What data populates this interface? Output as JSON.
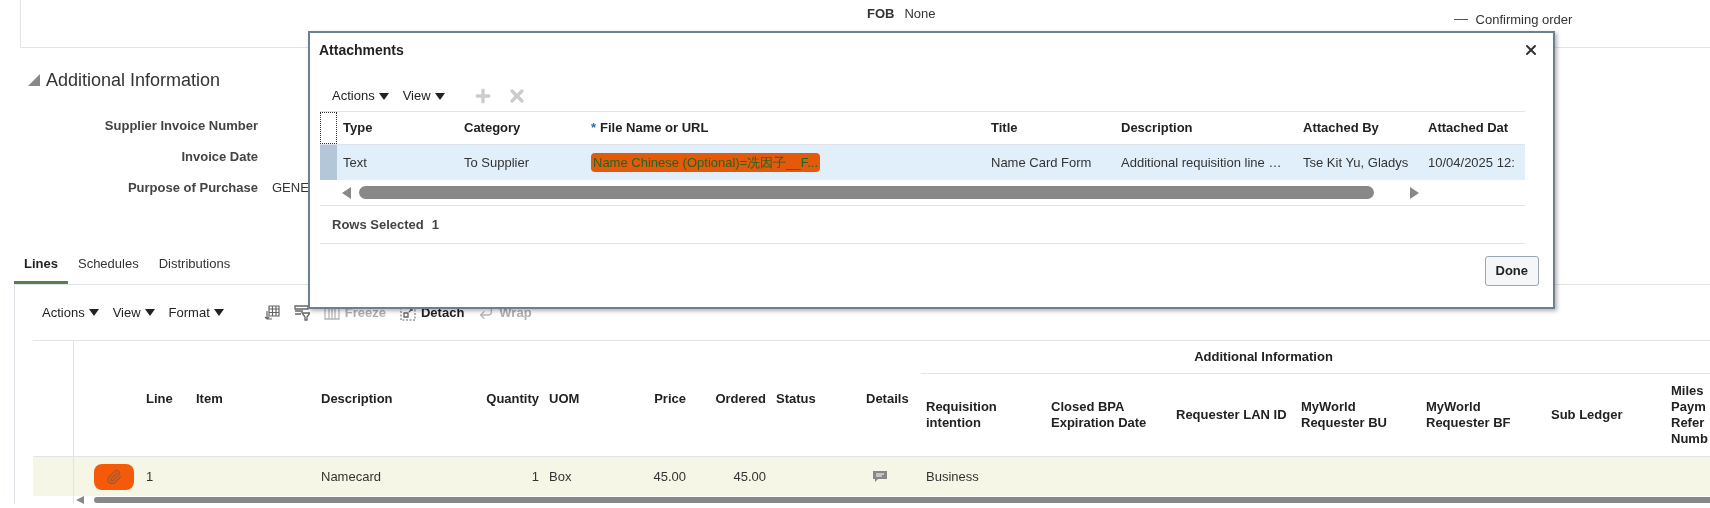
{
  "header": {
    "fob_label": "FOB",
    "fob_value": "None",
    "status_text": "Confirming order"
  },
  "additional_information": {
    "title": "Additional Information",
    "expanded": true,
    "fields": [
      {
        "label": "Supplier Invoice Number"
      },
      {
        "label": "Invoice Date"
      },
      {
        "label": "Purpose of Purchase",
        "value": "GENE"
      }
    ]
  },
  "tabs": [
    {
      "label": "Lines",
      "selected": true
    },
    {
      "label": "Schedules",
      "selected": false
    },
    {
      "label": "Distributions",
      "selected": false
    }
  ],
  "lines_toolbar": {
    "menus": [
      "Actions",
      "View",
      "Format"
    ],
    "buttons": [
      {
        "kind": "columns",
        "disabled": false
      },
      {
        "kind": "filter",
        "disabled": false
      },
      {
        "kind": "freeze",
        "label": "Freeze",
        "disabled": true
      },
      {
        "kind": "detach",
        "label": "Detach",
        "disabled": false
      },
      {
        "kind": "wrap",
        "label": "Wrap",
        "disabled": true
      }
    ]
  },
  "lines_table": {
    "group_header": "Additional Information",
    "columns": [
      "Line",
      "Item",
      "Description",
      "Quantity",
      "UOM",
      "Price",
      "Ordered",
      "Status",
      "Details"
    ],
    "group_columns": [
      "Requisition intention",
      "Closed BPA Expiration Date",
      "Requester LAN ID",
      "MyWorld Requester BU",
      "MyWorld Requester BF",
      "Sub Ledger",
      "Miles Paym Refer Numb"
    ],
    "rows": [
      {
        "selected": true,
        "attachment": true,
        "details": true,
        "line": "1",
        "description": "Namecard",
        "quantity": "1",
        "uom": "Box",
        "price": "45.00",
        "ordered": "45.00",
        "requisition_intention": "Business"
      }
    ]
  },
  "dialog": {
    "title": "Attachments",
    "toolbar": {
      "menus": [
        "Actions",
        "View"
      ],
      "add_disabled": true,
      "delete_disabled": true
    },
    "columns": [
      {
        "label": "Type"
      },
      {
        "label": "Category"
      },
      {
        "label": "File Name or URL",
        "required_mark": "*"
      },
      {
        "label": "Title"
      },
      {
        "label": "Description"
      },
      {
        "label": "Attached By"
      },
      {
        "label": "Attached Dat"
      }
    ],
    "rows": [
      {
        "selected": true,
        "redacted_file": true,
        "cells": [
          "Text",
          "To Supplier",
          "Name Chinese (Optional)=冼因子__F...",
          "Name Card Form",
          "Additional requisition line …",
          "Tse Kit Yu, Gladys",
          "10/04/2025 12:"
        ]
      }
    ],
    "rows_selected_label": "Rows Selected",
    "rows_selected_count": "1",
    "done_button": "Done"
  }
}
